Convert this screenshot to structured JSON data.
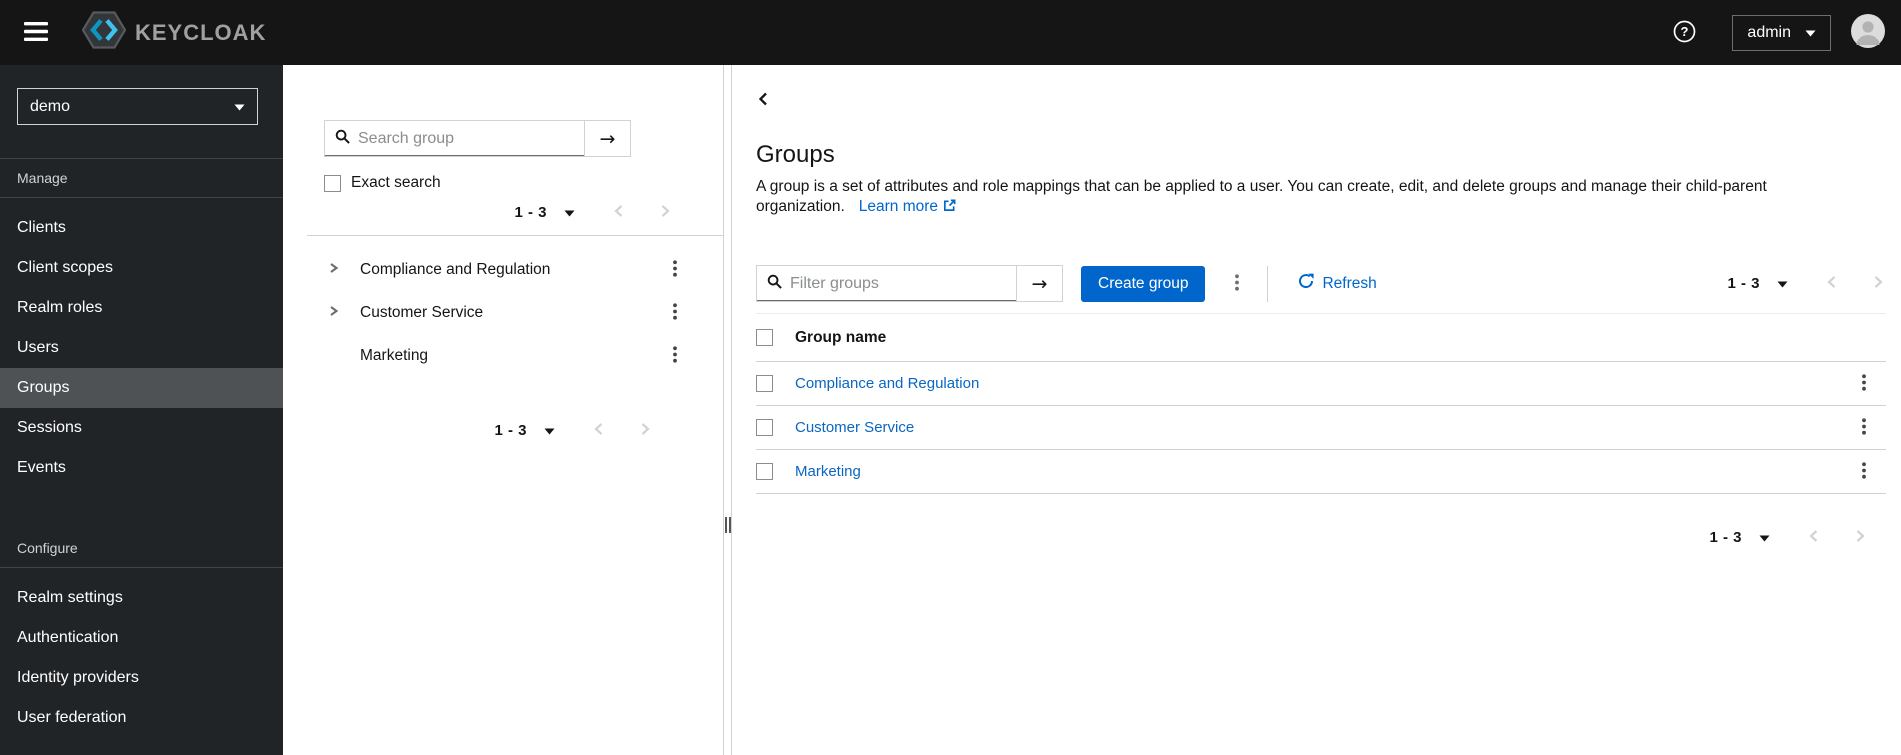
{
  "masthead": {
    "brand": "KEYCLOAK",
    "username": "admin"
  },
  "sidebar": {
    "realm": "demo",
    "selected_item": "Groups",
    "sections": [
      {
        "label": "Manage",
        "items": [
          "Clients",
          "Client scopes",
          "Realm roles",
          "Users",
          "Groups",
          "Sessions",
          "Events"
        ]
      },
      {
        "label": "Configure",
        "items": [
          "Realm settings",
          "Authentication",
          "Identity providers",
          "User federation"
        ]
      }
    ]
  },
  "tree_panel": {
    "search_placeholder": "Search group",
    "exact_search_label": "Exact search",
    "pagination_top": "1 - 3",
    "pagination_bottom": "1 - 3",
    "groups": [
      {
        "label": "Compliance and Regulation",
        "expandable": true
      },
      {
        "label": "Customer Service",
        "expandable": true
      },
      {
        "label": "Marketing",
        "expandable": false
      }
    ]
  },
  "main": {
    "title": "Groups",
    "description": "A group is a set of attributes and role mappings that can be applied to a user. You can create, edit, and delete groups and manage their child-parent organization.",
    "learn_more_label": "Learn more",
    "toolbar": {
      "filter_placeholder": "Filter groups",
      "create_button_label": "Create group",
      "refresh_label": "Refresh",
      "pagination": "1 - 3"
    },
    "table": {
      "column_header": "Group name",
      "rows": [
        {
          "name": "Compliance and Regulation"
        },
        {
          "name": "Customer Service"
        },
        {
          "name": "Marketing"
        }
      ]
    },
    "pagination_bottom": "1 - 3"
  },
  "colors": {
    "primary_button": "#0066cc",
    "link": "#0a66c2",
    "masthead_bg": "#151515",
    "sidebar_bg": "#212427",
    "sidebar_selected_bg": "#4f5255",
    "border": "#d2d2d2"
  }
}
